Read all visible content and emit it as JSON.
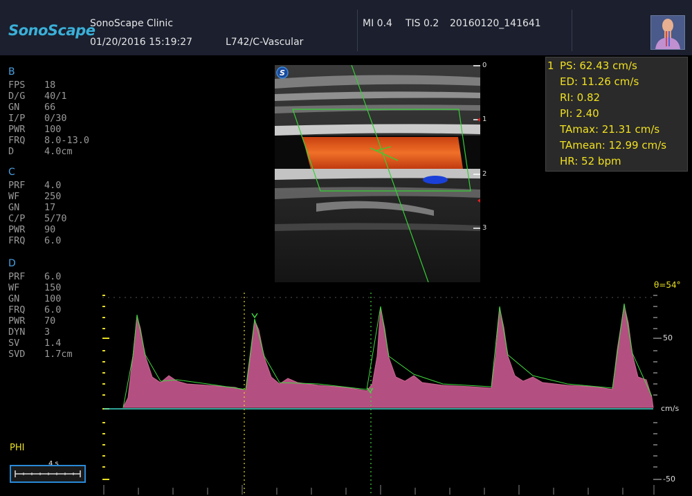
{
  "header": {
    "logo": "SonoScape",
    "clinic": "SonoScape Clinic",
    "datetime": "01/20/2016 15:19:27",
    "probe": "L742/C-Vascular",
    "mi": "MI  0.4",
    "tis": "TIS  0.2",
    "file_id": "20160120_141641"
  },
  "params": {
    "b": {
      "title": "B",
      "rows": [
        {
          "k": "FPS",
          "v": "18"
        },
        {
          "k": "D/G",
          "v": "40/1"
        },
        {
          "k": "GN",
          "v": "66"
        },
        {
          "k": "I/P",
          "v": "0/30"
        },
        {
          "k": "PWR",
          "v": "100"
        },
        {
          "k": "FRQ",
          "v": "8.0-13.0"
        },
        {
          "k": "D",
          "v": "4.0cm"
        }
      ]
    },
    "c": {
      "title": "C",
      "rows": [
        {
          "k": "PRF",
          "v": "4.0"
        },
        {
          "k": "WF",
          "v": "250"
        },
        {
          "k": "GN",
          "v": "17"
        },
        {
          "k": "C/P",
          "v": "5/70"
        },
        {
          "k": "PWR",
          "v": "90"
        },
        {
          "k": "FRQ",
          "v": "6.0"
        }
      ]
    },
    "d": {
      "title": "D",
      "rows": [
        {
          "k": "PRF",
          "v": "6.0"
        },
        {
          "k": "WF",
          "v": "150"
        },
        {
          "k": "GN",
          "v": "100"
        },
        {
          "k": "FRQ",
          "v": "6.0"
        },
        {
          "k": "PWR",
          "v": "70"
        },
        {
          "k": "DYN",
          "v": "3"
        },
        {
          "k": "SV",
          "v": "1.4"
        },
        {
          "k": "SVD",
          "v": "1.7cm"
        }
      ]
    }
  },
  "depth_labels": [
    "0",
    "1",
    "2",
    "3"
  ],
  "measurements": {
    "index": "1",
    "ps": "PS: 62.43  cm/s",
    "ed": "ED: 11.26  cm/s",
    "ri": "RI: 0.82",
    "pi": "PI: 2.40",
    "tamax": "TAmax: 21.31  cm/s",
    "tamean": "TAmean: 12.99  cm/s",
    "hr": "HR: 52     bpm"
  },
  "doppler": {
    "angle": "θ=54°",
    "scale_top": "50",
    "unit": "cm/s",
    "scale_bottom": "-50",
    "phi": "PHI",
    "time_scale": "4 s"
  },
  "colors": {
    "header_bg": "#1b1f2e",
    "accent_blue": "#4aa0e0",
    "measure_text": "#f0e020",
    "baseline": "#40d8c8",
    "color_flow": "#e05a20",
    "spectrum": "#e070a0"
  }
}
